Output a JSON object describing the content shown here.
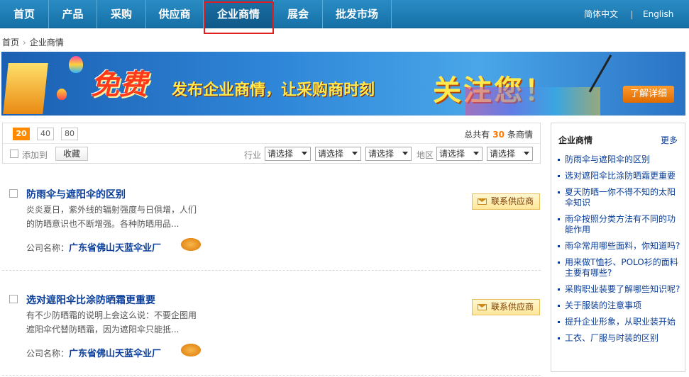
{
  "nav": {
    "items": [
      "首页",
      "产品",
      "采购",
      "供应商",
      "企业商情",
      "展会",
      "批发市场"
    ],
    "active_index": 4,
    "lang": [
      "简体中文",
      "English"
    ]
  },
  "breadcrumb": [
    "首页",
    "企业商情"
  ],
  "banner": {
    "free": "免费",
    "subtitle": "发布企业商情，让采购商时刻",
    "subtitle2": "关注您！",
    "button": "了解详细"
  },
  "filter": {
    "page_sizes": [
      "20",
      "40",
      "80"
    ],
    "active_page_size": "20",
    "total_prefix": "总共有",
    "total_count": "30",
    "total_suffix": "条商情",
    "add_to_label": "添加到",
    "favorite_button": "收藏",
    "industry_label": "行业",
    "region_label": "地区",
    "select_placeholder": "请选择"
  },
  "items": [
    {
      "title": "防雨伞与遮阳伞的区别",
      "desc_line1": "炎炎夏日，紫外线的辐射强度与日俱增，人们",
      "desc_line2": "的防晒意识也不断增强。各种防晒用品...",
      "company_label": "公司名称：",
      "company": "广东省佛山天蓝伞业厂",
      "contact": "联系供应商"
    },
    {
      "title": "选对遮阳伞比涂防晒霜更重要",
      "desc_line1": "有不少防晒霜的说明上会这么说：不要企图用",
      "desc_line2": "遮阳伞代替防晒霜，因为遮阳伞只能抵...",
      "company_label": "公司名称：",
      "company": "广东省佛山天蓝伞业厂",
      "contact": "联系供应商"
    }
  ],
  "sidebar": {
    "title": "企业商情",
    "more": "更多",
    "items": [
      "防雨伞与遮阳伞的区别",
      "选对遮阳伞比涂防晒霜更重要",
      "夏天防晒一你不得不知的太阳伞知识",
      "雨伞按照分类方法有不同的功能作用",
      "雨伞常用哪些面料，你知道吗?",
      "用来做T恤衫、POLO衫的面料主要有哪些?",
      "采购职业装要了解哪些知识呢?",
      "关于服装的注意事项",
      "提升企业形象，从职业装开始",
      "工衣、厂服与时装的区别"
    ]
  },
  "colors": {
    "nav_bg": "#1f7fb8",
    "accent": "#ff8a00",
    "link": "#0a3e9a",
    "highlight": "#e01f1f"
  }
}
